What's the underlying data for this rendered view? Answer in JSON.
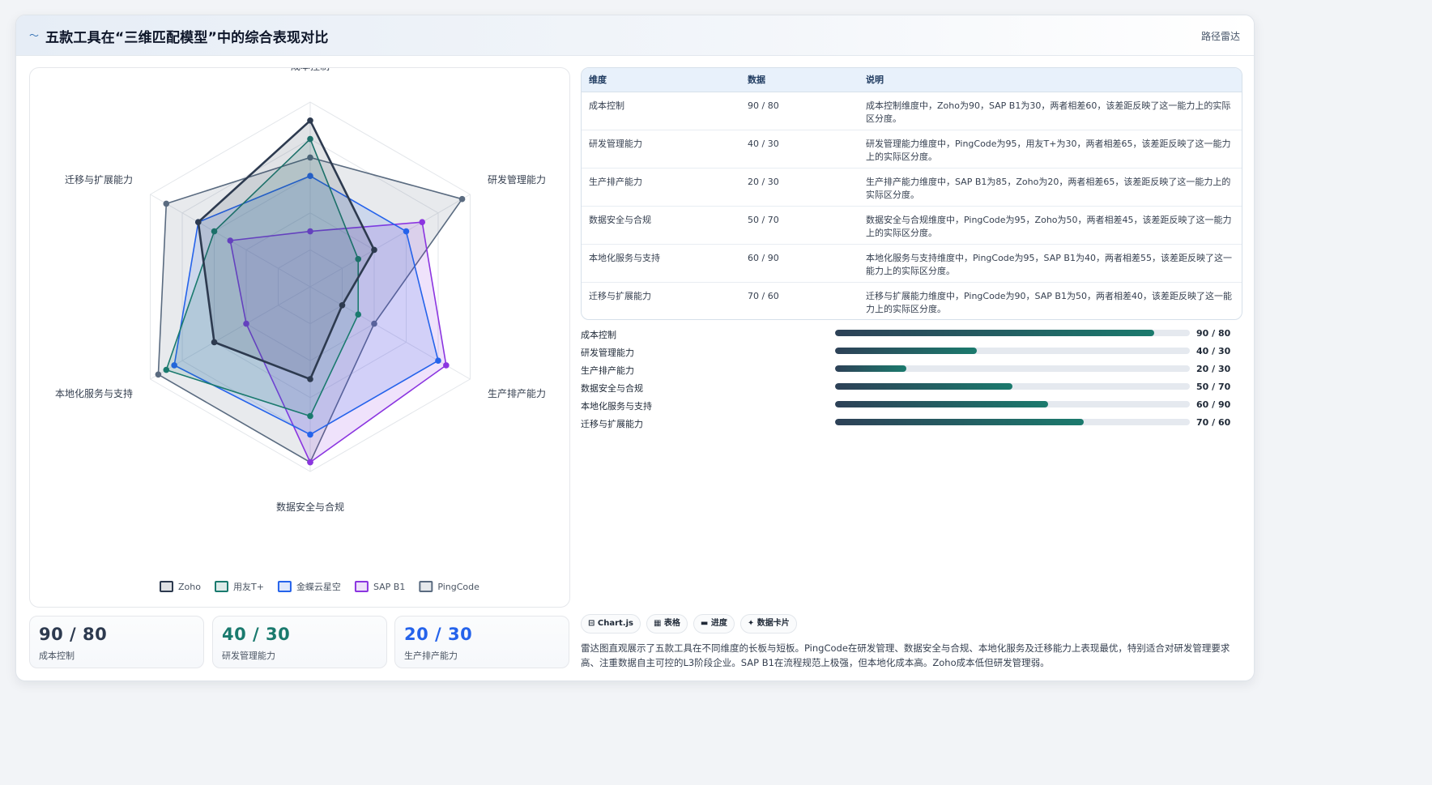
{
  "header": {
    "icon": "wave-icon",
    "title": "五款工具在“三维匹配模型”中的综合表现对比",
    "badge": "路径雷达"
  },
  "chart_data": {
    "type": "radar",
    "axes": [
      "成本控制",
      "研发管理能力",
      "生产排产能力",
      "数据安全与合规",
      "本地化服务与支持",
      "迁移与扩展能力"
    ],
    "r_range": [
      0,
      100
    ],
    "legend_position": "bottom",
    "series": [
      {
        "name": "Zoho",
        "color": "#2d3a4f",
        "values": [
          90,
          40,
          20,
          50,
          60,
          70
        ]
      },
      {
        "name": "用友T+",
        "color": "#1a7a6e",
        "values": [
          80,
          30,
          30,
          70,
          90,
          60
        ]
      },
      {
        "name": "金蝶云星空",
        "color": "#2563eb",
        "values": [
          60,
          60,
          80,
          80,
          85,
          70
        ]
      },
      {
        "name": "SAP B1",
        "color": "#8b35e0",
        "values": [
          30,
          70,
          85,
          95,
          40,
          50
        ]
      },
      {
        "name": "PingCode",
        "color": "#5a6b80",
        "values": [
          70,
          95,
          40,
          95,
          95,
          90
        ]
      }
    ]
  },
  "stats": [
    {
      "value": "90 / 80",
      "label": "成本控制",
      "color": "#2d3a4f"
    },
    {
      "value": "40 / 30",
      "label": "研发管理能力",
      "color": "#1a7a6e"
    },
    {
      "value": "20 / 30",
      "label": "生产排产能力",
      "color": "#2563eb"
    }
  ],
  "table": {
    "headers": [
      "维度",
      "数据",
      "说明"
    ],
    "rows": [
      [
        "成本控制",
        "90 / 80",
        "成本控制维度中，Zoho为90，SAP B1为30，两者相差60，该差距反映了这一能力上的实际区分度。"
      ],
      [
        "研发管理能力",
        "40 / 30",
        "研发管理能力维度中，PingCode为95，用友T+为30，两者相差65，该差距反映了这一能力上的实际区分度。"
      ],
      [
        "生产排产能力",
        "20 / 30",
        "生产排产能力维度中，SAP B1为85，Zoho为20，两者相差65，该差距反映了这一能力上的实际区分度。"
      ],
      [
        "数据安全与合规",
        "50 / 70",
        "数据安全与合规维度中，PingCode为95，Zoho为50，两者相差45，该差距反映了这一能力上的实际区分度。"
      ],
      [
        "本地化服务与支持",
        "60 / 90",
        "本地化服务与支持维度中，PingCode为95，SAP B1为40，两者相差55，该差距反映了这一能力上的实际区分度。"
      ],
      [
        "迁移与扩展能力",
        "70 / 60",
        "迁移与扩展能力维度中，PingCode为90，SAP B1为50，两者相差40，该差距反映了这一能力上的实际区分度。"
      ]
    ]
  },
  "progress": [
    {
      "label": "成本控制",
      "value": "90 / 80",
      "fraction": 0.9
    },
    {
      "label": "研发管理能力",
      "value": "40 / 30",
      "fraction": 0.4
    },
    {
      "label": "生产排产能力",
      "value": "20 / 30",
      "fraction": 0.2
    },
    {
      "label": "数据安全与合规",
      "value": "50 / 70",
      "fraction": 0.5
    },
    {
      "label": "本地化服务与支持",
      "value": "60 / 90",
      "fraction": 0.6
    },
    {
      "label": "迁移与扩展能力",
      "value": "70 / 60",
      "fraction": 0.7
    }
  ],
  "chips": [
    {
      "icon": "chart-icon",
      "glyph": "⊟",
      "label": "Chart.js"
    },
    {
      "icon": "table-icon",
      "glyph": "▦",
      "label": "表格"
    },
    {
      "icon": "progress-icon",
      "glyph": "▬",
      "label": "进度"
    },
    {
      "icon": "card-icon",
      "glyph": "✦",
      "label": "数据卡片"
    }
  ],
  "summary": "雷达图直观展示了五款工具在不同维度的长板与短板。PingCode在研发管理、数据安全与合规、本地化服务及迁移能力上表现最优，特别适合对研发管理要求高、注重数据自主可控的L3阶段企业。SAP B1在流程规范上极强，但本地化成本高。Zoho成本低但研发管理弱。"
}
